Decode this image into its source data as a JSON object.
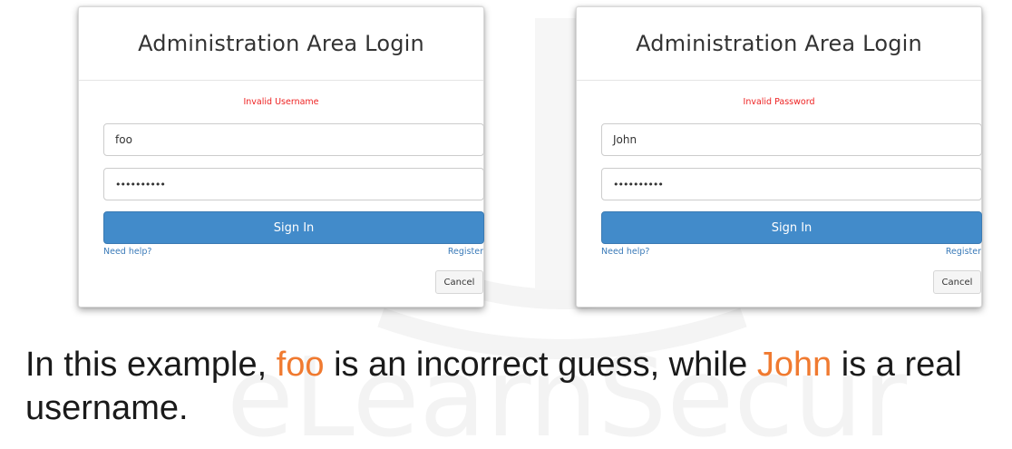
{
  "panels": [
    {
      "title": "Administration Area Login",
      "error": "Invalid Username",
      "username_value": "foo",
      "password_value": "••••••••••",
      "signin_label": "Sign In",
      "help_link": "Need help?",
      "register_link": "Register",
      "cancel_label": "Cancel"
    },
    {
      "title": "Administration Area Login",
      "error": "Invalid Password",
      "username_value": "John",
      "password_value": "••••••••••",
      "signin_label": "Sign In",
      "help_link": "Need help?",
      "register_link": "Register",
      "cancel_label": "Cancel"
    }
  ],
  "caption": {
    "part1": "In this example, ",
    "highlight1": "foo",
    "part2": " is an incorrect guess, while ",
    "highlight2": "John",
    "part3": " is a real username."
  },
  "colors": {
    "error": "#ee2222",
    "primary_button": "#428bca",
    "link": "#3a7ab8",
    "highlight": "#f07a30"
  },
  "icons": {
    "watermark": "elearnsecurity-logo-watermark"
  }
}
